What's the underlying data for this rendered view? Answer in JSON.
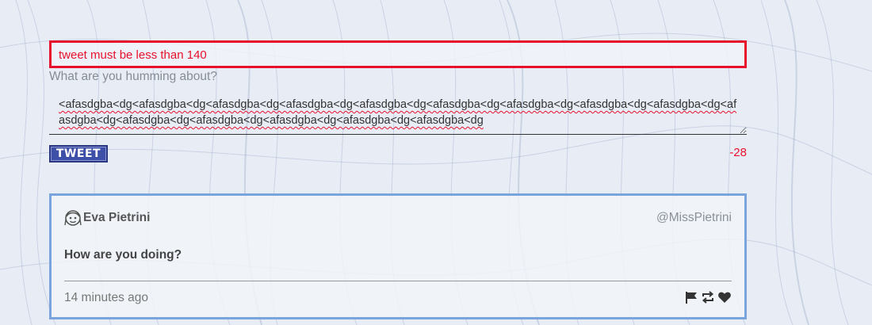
{
  "compose": {
    "error_message": "tweet must be less than 140",
    "prompt_label": "What are you humming about?",
    "tweet_text": "<afasdgba<dg<afasdgba<dg<afasdgba<dg<afasdgba<dg<afasdgba<dg<afasdgba<dg<afasdgba<dg<afasdgba<dg<afasdgba<dg<afasdgba<dg<afasdgba<dg<afasdgba<dg<afasdgba<dg<afasdgba<dg<afasdgba<dg",
    "tweet_button_label": "TWEET",
    "remaining_chars": "-28"
  },
  "feed": {
    "tweets": [
      {
        "author_name": "Eva Pietrini",
        "author_handle": "@MissPietrini",
        "avatar_icon": "avatar-icon",
        "body": "How are you doing?",
        "timestamp": "14 minutes ago",
        "actions": [
          "flag-icon",
          "retweet-icon",
          "heart-icon"
        ]
      }
    ]
  },
  "colors": {
    "error": "#e8112d",
    "card_border": "#7aa5dc",
    "button_bg": "#3d4fa6"
  }
}
